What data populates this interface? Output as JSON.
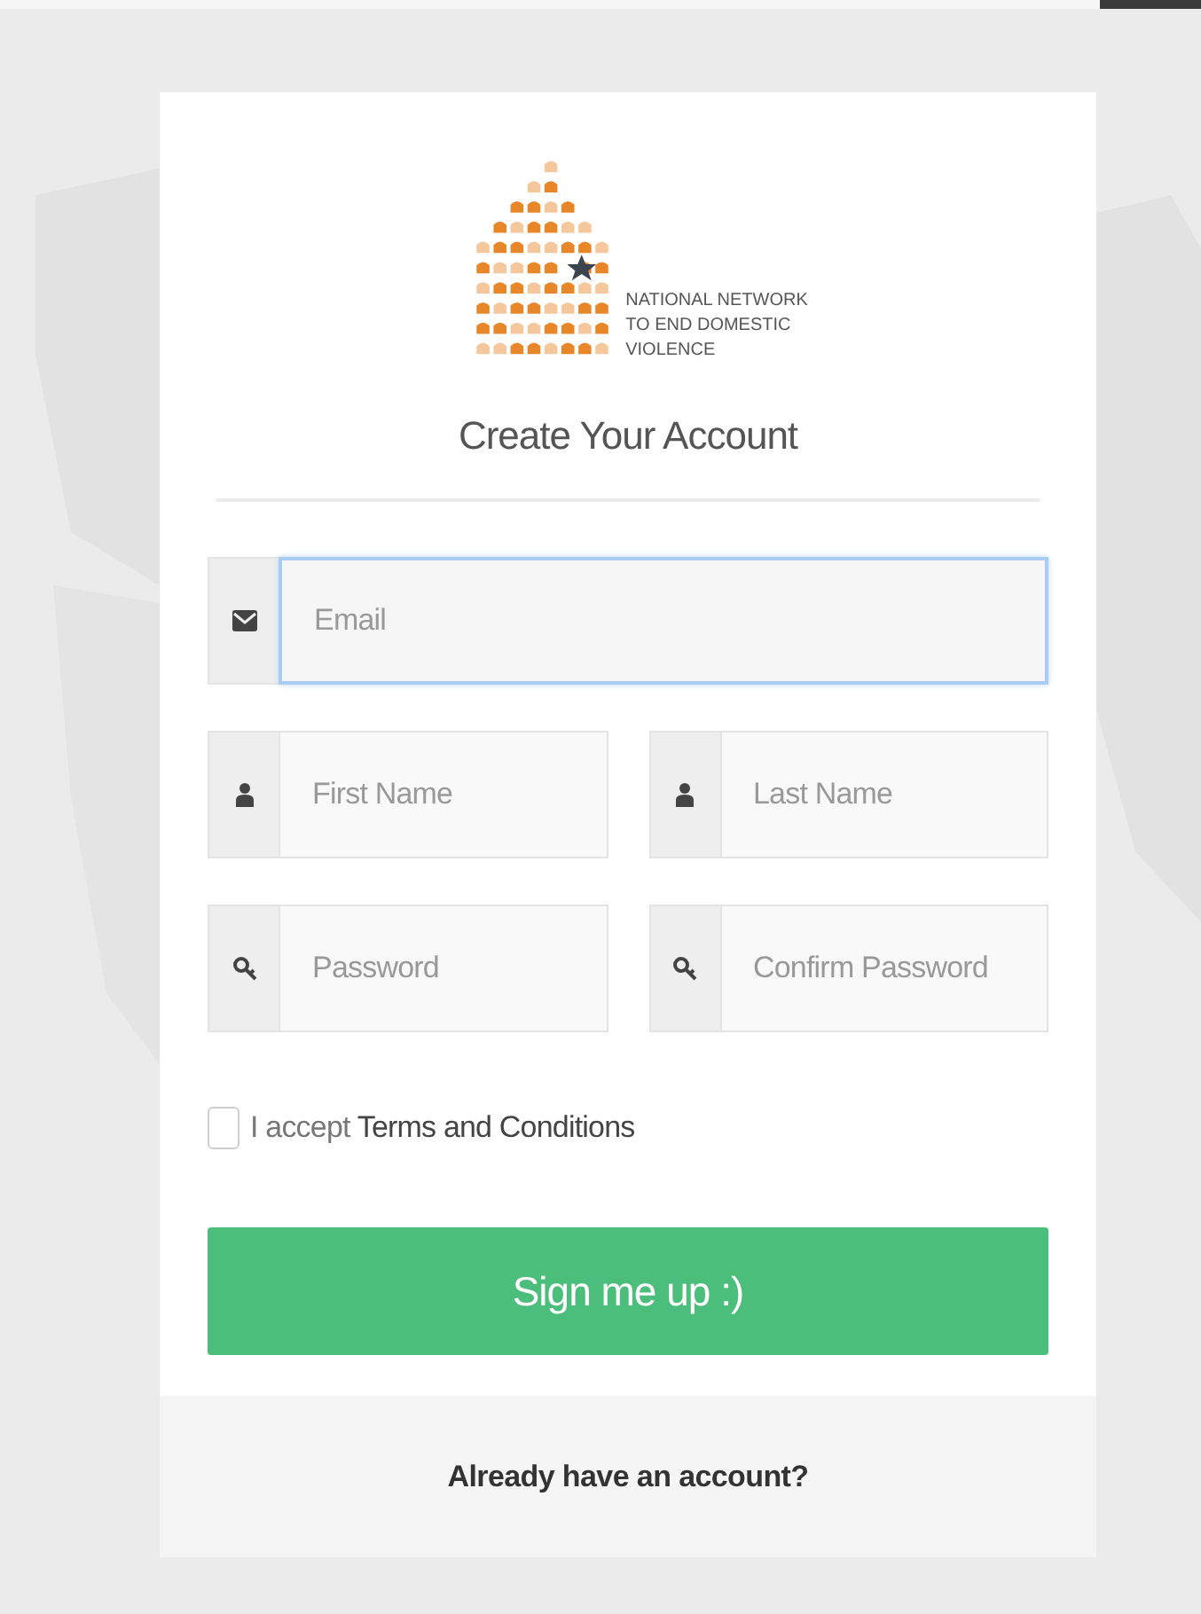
{
  "logo": {
    "lines": [
      "NATIONAL NETWORK",
      "TO END DOMESTIC",
      "VIOLENCE"
    ]
  },
  "title": "Create Your Account",
  "field_rows": [
    [
      {
        "kind": "email",
        "placeholder": "Email",
        "focused": true
      }
    ],
    [
      {
        "kind": "person",
        "placeholder": "First Name",
        "focused": false
      },
      {
        "kind": "person",
        "placeholder": "Last Name",
        "focused": false
      }
    ],
    [
      {
        "kind": "key",
        "placeholder": "Password",
        "focused": false
      },
      {
        "kind": "key",
        "placeholder": "Confirm Password",
        "focused": false
      }
    ]
  ],
  "terms": {
    "checked": false,
    "label": "I accept",
    "link": "Terms and Conditions"
  },
  "submit_button": "Sign me up :)",
  "footer_link": "Already have an account?"
}
